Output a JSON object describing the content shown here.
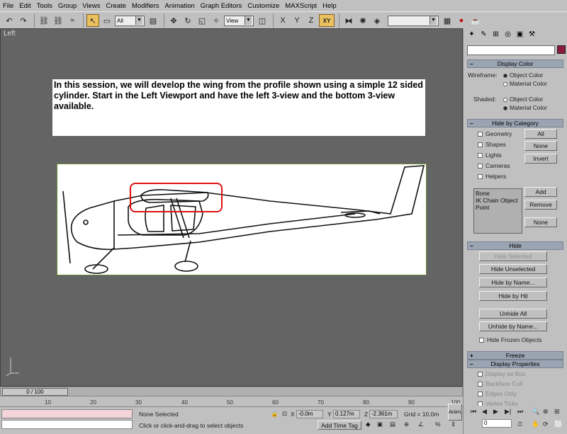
{
  "menu": [
    "File",
    "Edit",
    "Tools",
    "Group",
    "Views",
    "Create",
    "Modifiers",
    "Animation",
    "Graph Editors",
    "Customize",
    "MAXScript",
    "Help"
  ],
  "toolbar": {
    "selection_filter": "All",
    "ref_coord": "View",
    "constraint": "XY"
  },
  "viewport": {
    "label": "Left",
    "instructions": "In this session, we will develop the wing from the profile shown using a simple 12 sided cylinder.  Start in the Left Viewport and have the left 3-view and the bottom 3-view available."
  },
  "command_panel": {
    "display_color": {
      "title": "Display Color",
      "wireframe_label": "Wireframe:",
      "shaded_label": "Shaded:",
      "object_color": "Object Color",
      "material_color": "Material Color"
    },
    "hide_by_category": {
      "title": "Hide by Category",
      "items": [
        "Geometry",
        "Shapes",
        "Lights",
        "Cameras",
        "Helpers"
      ],
      "btn_all": "All",
      "btn_none": "None",
      "btn_invert": "Invert",
      "list": [
        "Bone",
        "IK Chain Object",
        "Point"
      ],
      "btn_add": "Add",
      "btn_remove": "Remove",
      "btn_none2": "None"
    },
    "hide": {
      "title": "Hide",
      "hide_selected": "Hide Selected",
      "hide_unselected": "Hide Unselected",
      "hide_by_name": "Hide by Name...",
      "hide_by_hit": "Hide by Hit",
      "unhide_all": "Unhide All",
      "unhide_by_name": "Unhide by Name...",
      "hide_frozen": "Hide Frozen Objects"
    },
    "freeze": {
      "title": "Freeze"
    },
    "display_properties": {
      "title": "Display Properties",
      "items": [
        "Display as Box",
        "Backface Cull",
        "Edges Only",
        "Vertex Ticks"
      ]
    }
  },
  "timeline": {
    "frame": "0 / 100",
    "ticks": [
      "10",
      "20",
      "30",
      "40",
      "50",
      "60",
      "70",
      "80",
      "90",
      "100"
    ]
  },
  "status": {
    "selection": "None Selected",
    "prompt": "Click or click-and-drag to select objects",
    "x_label": "X",
    "x": "-0.0m",
    "y_label": "Y",
    "y": "0.127m",
    "z_label": "Z",
    "z": "-2.361m",
    "grid": "Grid = 10.0m",
    "add_time_tag": "Add Time Tag",
    "anim": "Anim.",
    "frame_field": "0"
  }
}
